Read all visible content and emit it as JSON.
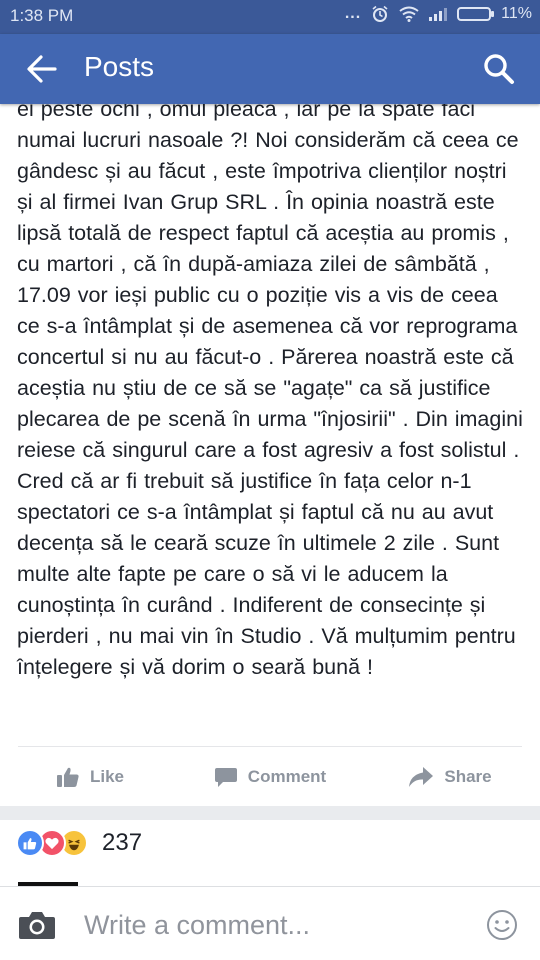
{
  "status_bar": {
    "time": "1:38 PM",
    "dots": "...",
    "battery": "11%"
  },
  "app_bar": {
    "title": "Posts",
    "back_icon": "arrow-left-icon",
    "search_icon": "search-icon"
  },
  "post": {
    "text": "ei peste ochi , omul pleacă , iar pe la spate faci numai lucruri nasoale ?! Noi considerăm că ceea ce gândesc și au făcut , este împotriva clienților noștri și al firmei Ivan Grup SRL . În opinia noastră este lipsă totală de respect faptul că aceștia au promis , cu martori , că în după-amiaza zilei de sâmbătă , 17.09 vor ieși public cu o poziție vis a vis de ceea ce s-a întâmplat și de asemenea că vor reprograma concertul si nu au făcut-o . Părerea noastră este că aceștia nu știu de ce să se \"agațe\" ca să justifice plecarea de pe scenă în urma \"înjosirii\" . Din imagini reiese că singurul care a fost agresiv a fost solistul . Cred că ar fi trebuit să justifice în fața celor n-1 spectatori ce s-a întâmplat și faptul că nu au avut decența să le ceară scuze în ultimele 2 zile . Sunt multe alte fapte  pe care o să vi le aducem la cunoștința în curând . Indiferent de consecințe și pierderi , nu mai vin în Studio . Vă mulțumim pentru înțelegere și vă dorim o seară bună !"
  },
  "actions": {
    "like": "Like",
    "comment": "Comment",
    "share": "Share"
  },
  "reactions": {
    "count": "237",
    "types": [
      "like",
      "love",
      "haha"
    ]
  },
  "composer": {
    "placeholder": "Write a comment...",
    "camera_icon": "camera-icon",
    "emoji_icon": "smiley-icon"
  },
  "colors": {
    "status_bar": "#3b5998",
    "app_bar": "#4267b2",
    "action_text": "#8d949e"
  }
}
